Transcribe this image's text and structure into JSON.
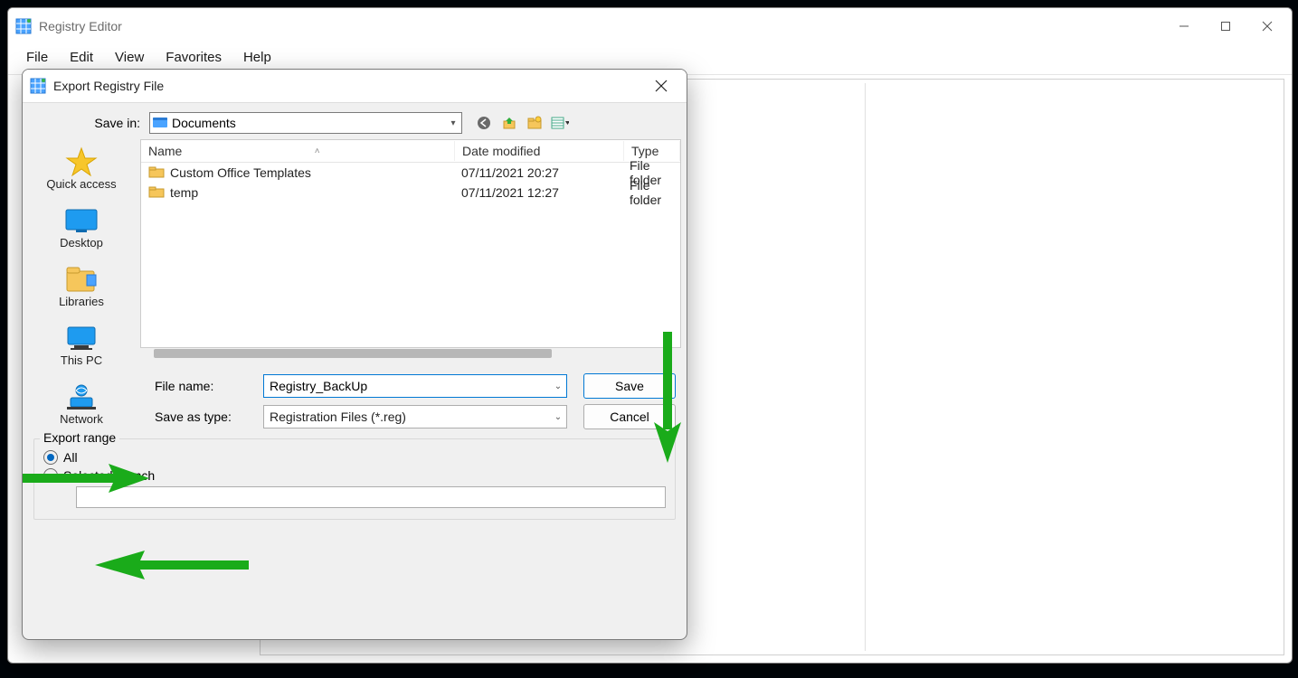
{
  "main_window": {
    "title": "Registry Editor",
    "menu": [
      "File",
      "Edit",
      "View",
      "Favorites",
      "Help"
    ]
  },
  "dialog": {
    "title": "Export Registry File",
    "save_in_label": "Save in:",
    "save_in_value": "Documents",
    "toolbar_icons": [
      "back-icon",
      "up-one-level-icon",
      "new-folder-icon",
      "view-menu-icon"
    ],
    "places": [
      {
        "label": "Quick access",
        "icon": "star-icon"
      },
      {
        "label": "Desktop",
        "icon": "desktop-icon"
      },
      {
        "label": "Libraries",
        "icon": "libraries-icon"
      },
      {
        "label": "This PC",
        "icon": "thispc-icon"
      },
      {
        "label": "Network",
        "icon": "network-icon"
      }
    ],
    "columns": {
      "name": "Name",
      "date": "Date modified",
      "type": "Type"
    },
    "rows": [
      {
        "name": "Custom Office Templates",
        "date": "07/11/2021 20:27",
        "type": "File folder"
      },
      {
        "name": "temp",
        "date": "07/11/2021 12:27",
        "type": "File folder"
      }
    ],
    "filename_label": "File name:",
    "filename_value": "Registry_BackUp",
    "saveas_label": "Save as type:",
    "saveas_value": "Registration Files (*.reg)",
    "save_btn": "Save",
    "cancel_btn": "Cancel",
    "export_range_label": "Export range",
    "radio_all": "All",
    "radio_selected": "Selected branch",
    "radio_state": "all"
  }
}
